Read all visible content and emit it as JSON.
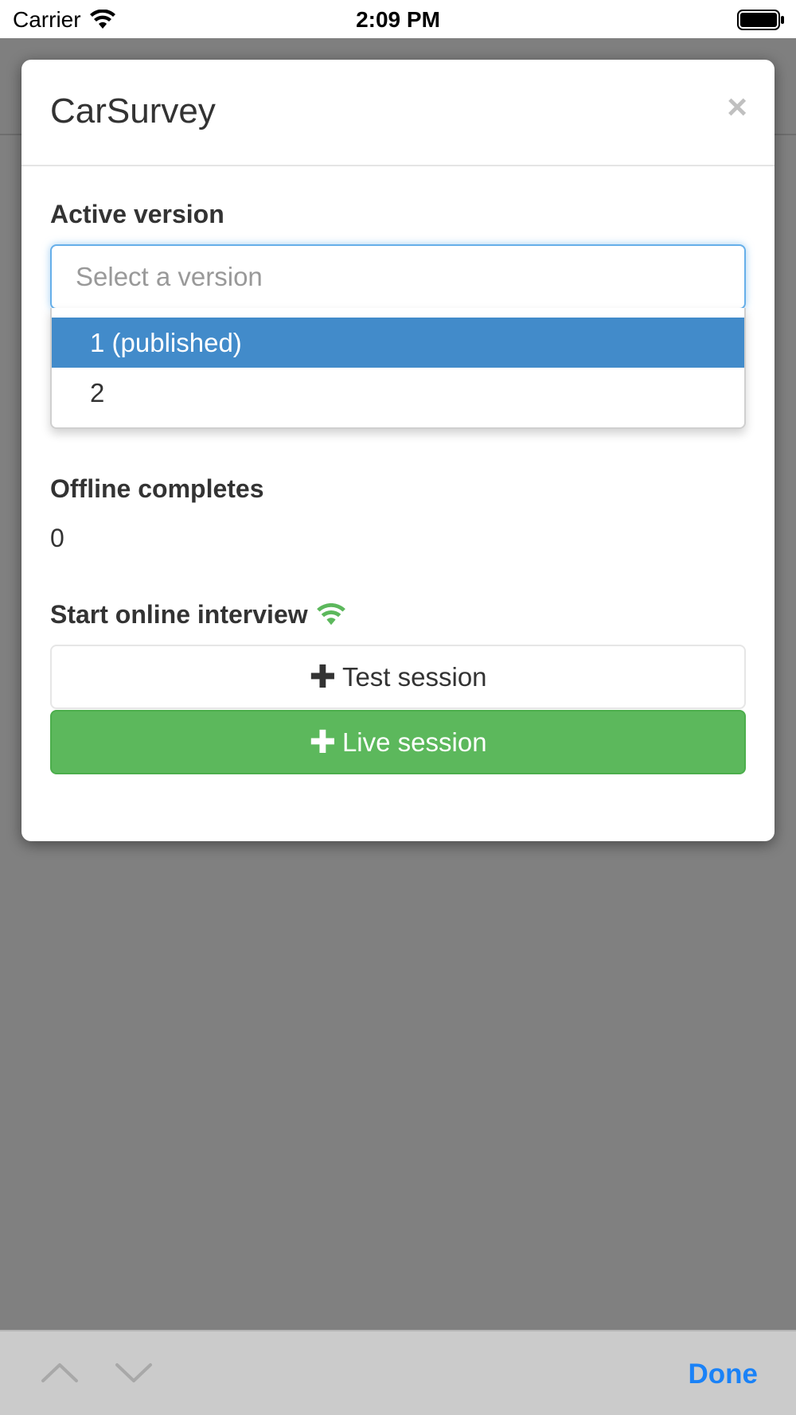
{
  "status_bar": {
    "carrier": "Carrier",
    "time": "2:09 PM"
  },
  "modal": {
    "title": "CarSurvey",
    "close_label": "×",
    "active_version": {
      "label": "Active version",
      "placeholder": "Select a version",
      "options": [
        "1 (published)",
        "2"
      ],
      "selected_index": 0
    },
    "offline_completes": {
      "label": "Offline completes",
      "value": "0"
    },
    "online_interview": {
      "label": "Start online interview",
      "wifi_icon_color": "#5cb85c",
      "test_session_label": "Test session",
      "live_session_label": "Live session"
    }
  },
  "accessory_bar": {
    "done_label": "Done"
  },
  "colors": {
    "primary_selected": "#428bca",
    "success": "#5cb85c",
    "done_blue": "#1a82f7",
    "focus_border": "#66afe9"
  }
}
